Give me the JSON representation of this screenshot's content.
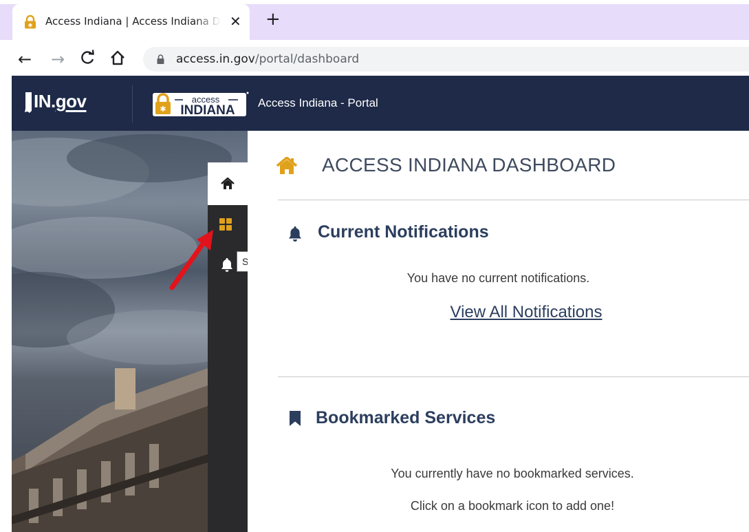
{
  "browser": {
    "tab_title": "Access Indiana | Access Indiana Dashboard",
    "tab_close": "✕",
    "new_tab": "+",
    "url_host": "access.in.gov",
    "url_path": "/portal/dashboard",
    "nav": {
      "back": "←",
      "forward": "→",
      "reload": "C",
      "home": "⌂"
    }
  },
  "header": {
    "ingov_prefix": "IN.",
    "ingov_suffix": "gov",
    "logo_text_top": "access",
    "logo_text_bottom": "INDIANA",
    "site_title": "Access Indiana - Portal"
  },
  "sidenav": {
    "tooltip": "Services"
  },
  "dashboard": {
    "title": "ACCESS INDIANA DASHBOARD",
    "notifications": {
      "heading": "Current Notifications",
      "empty_text": "You have no current notifications.",
      "link": "View All Notifications"
    },
    "bookmarks": {
      "heading": "Bookmarked Services",
      "empty_text": "You currently have no bookmarked services.",
      "hint": "Click on a bookmark icon to add one!"
    }
  },
  "colors": {
    "header_bg": "#1e2a48",
    "accent_gold": "#e0a11b",
    "heading_navy": "#2c3e5e",
    "tab_strip": "#e7dcfa",
    "annotation_arrow": "#e3131b"
  }
}
